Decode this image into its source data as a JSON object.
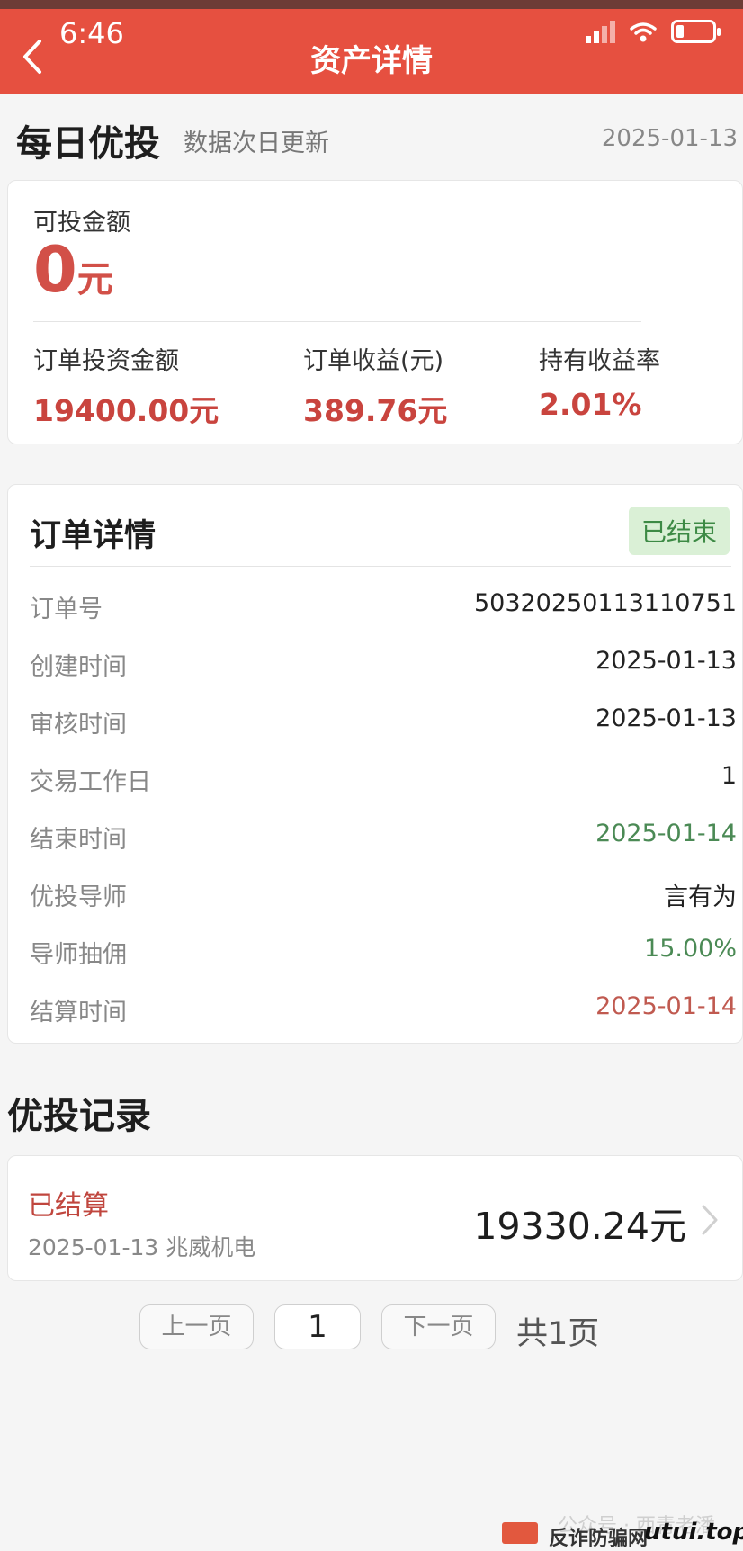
{
  "status_bar": {
    "time": "6:46"
  },
  "nav": {
    "title": "资产详情"
  },
  "header": {
    "title": "每日优投",
    "subtitle": "数据次日更新",
    "date": "2025-01-13"
  },
  "summary": {
    "available_label": "可投金额",
    "available_value": "0",
    "available_unit": "元",
    "stats": [
      {
        "label": "订单投资金额",
        "value": "19400.00元"
      },
      {
        "label": "订单收益(元)",
        "value": "389.76元"
      },
      {
        "label": "持有收益率",
        "value": "2.01%"
      }
    ]
  },
  "order": {
    "title": "订单详情",
    "status": "已结束",
    "rows": [
      {
        "key": "订单号",
        "value": "50320250113110751"
      },
      {
        "key": "创建时间",
        "value": "2025-01-13"
      },
      {
        "key": "审核时间",
        "value": "2025-01-13"
      },
      {
        "key": "交易工作日",
        "value": "1"
      },
      {
        "key": "结束时间",
        "value": "2025-01-14"
      },
      {
        "key": "优投导师",
        "value": "言有为"
      },
      {
        "key": "导师抽佣",
        "value": "15.00%"
      },
      {
        "key": "结算时间",
        "value": "2025-01-14"
      }
    ]
  },
  "records": {
    "title": "优投记录",
    "items": [
      {
        "status": "已结算",
        "meta": "2025-01-13 兆威机电",
        "amount": "19330.24元"
      }
    ]
  },
  "pagination": {
    "prev": "上一页",
    "current": "1",
    "next": "下一页",
    "total": "共1页"
  },
  "watermark": {
    "text": "公众号 · 西青老潘",
    "site": "反诈防骗网",
    "domain": "utui.top"
  },
  "colors": {
    "nav_bg": "#e65040",
    "accent_red": "#c9443e",
    "green": "#4b8a55",
    "badge_bg": "#daf0d6"
  }
}
